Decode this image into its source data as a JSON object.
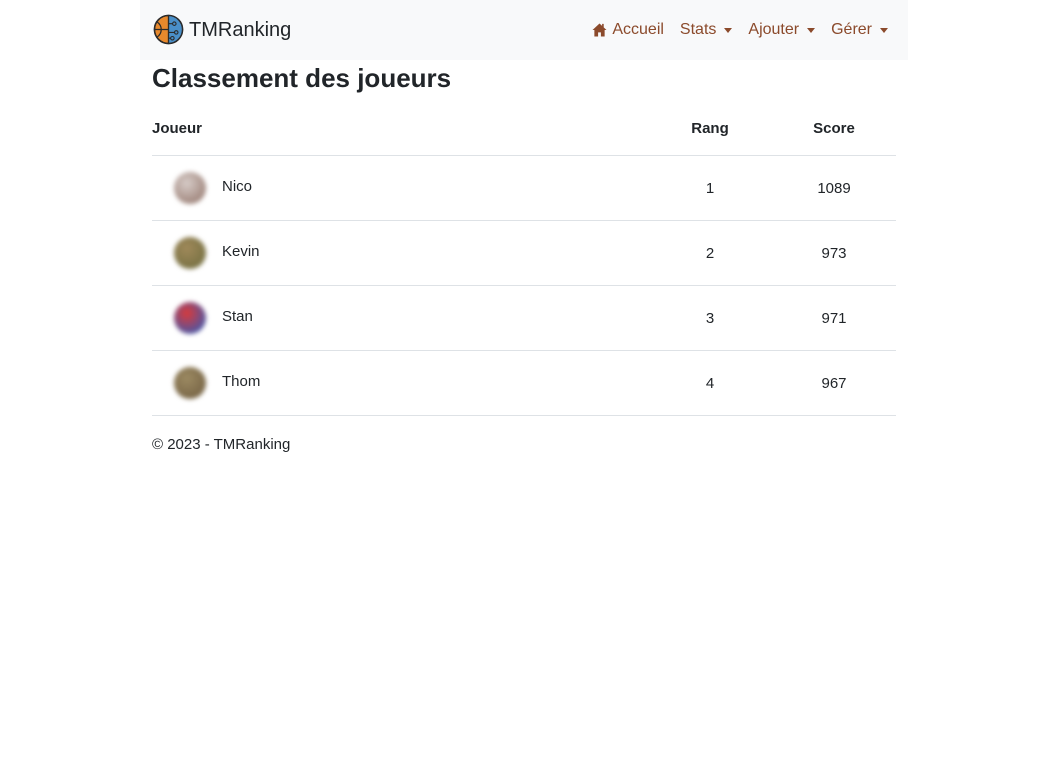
{
  "brand": {
    "name": "TMRanking",
    "logo_icon": "basketball-brain-logo"
  },
  "nav": {
    "home": {
      "label": "Accueil",
      "icon": "home-icon"
    },
    "stats": {
      "label": "Stats"
    },
    "add": {
      "label": "Ajouter"
    },
    "manage": {
      "label": "Gérer"
    },
    "link_color": "#8b4a2b"
  },
  "page": {
    "title": "Classement des joueurs"
  },
  "table": {
    "headers": {
      "player": "Joueur",
      "rank": "Rang",
      "score": "Score"
    },
    "rows": [
      {
        "name": "Nico",
        "rank": "1",
        "score": "1089",
        "avatar_colors": [
          "#8d6e63",
          "#d7ccc8"
        ]
      },
      {
        "name": "Kevin",
        "rank": "2",
        "score": "973",
        "avatar_colors": [
          "#6b6a3c",
          "#a0895a"
        ]
      },
      {
        "name": "Stan",
        "rank": "3",
        "score": "971",
        "avatar_colors": [
          "#1e5fc7",
          "#d93a3a"
        ]
      },
      {
        "name": "Thom",
        "rank": "4",
        "score": "967",
        "avatar_colors": [
          "#6d5a3e",
          "#9c8a62"
        ]
      }
    ]
  },
  "footer": {
    "text": "© 2023 - TMRanking"
  }
}
